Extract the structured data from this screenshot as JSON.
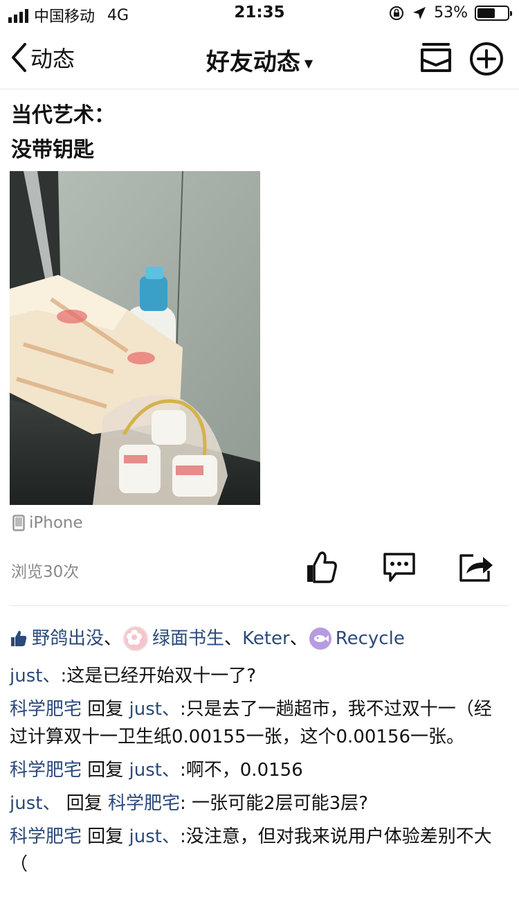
{
  "status_bar": {
    "carrier": "中国移动",
    "network": "4G",
    "time": "21:35",
    "battery": "53%",
    "battery_level": 0.53
  },
  "nav": {
    "back_label": "动态",
    "title": "好友动态"
  },
  "post": {
    "lines": [
      "当代艺术：",
      "没带钥匙"
    ],
    "device": "iPhone",
    "views": "浏览30次"
  },
  "likes": {
    "names": [
      "野鸽出没",
      "绿面书生",
      "Keter",
      "Recycle"
    ],
    "separator": "、"
  },
  "comments": [
    {
      "author": "just、",
      "reply_word": "",
      "target": "",
      "colon": ":",
      "text": "这是已经开始双十一了?"
    },
    {
      "author": "科学肥宅",
      "reply_word": " 回复 ",
      "target": "just、",
      "colon": ":",
      "text": "只是去了一趟超市，我不过双十一（经过计算双十一卫生纸0.00155一张，这个0.00156一张。"
    },
    {
      "author": "科学肥宅",
      "reply_word": " 回复 ",
      "target": "just、",
      "colon": ":",
      "text": "啊不，0.0156"
    },
    {
      "author": "just、",
      "reply_word": " 回复 ",
      "target": "科学肥宅",
      "colon": ": ",
      "text": "一张可能2层可能3层?"
    },
    {
      "author": "科学肥宅",
      "reply_word": " 回复 ",
      "target": "just、",
      "colon": ":",
      "text": "没注意，但对我来说用户体验差别不大（"
    }
  ],
  "colors": {
    "link": "#2b4a7a",
    "muted": "#888888",
    "avatar2": "#f4c6cc",
    "avatar4": "#b79be0"
  },
  "icons": [
    "signal-icon",
    "lock-rotation-icon",
    "location-arrow-icon",
    "battery-icon",
    "back-chevron-icon",
    "dropdown-caret-icon",
    "mail-icon",
    "add-circle-icon",
    "phone-icon",
    "like-icon",
    "comment-icon",
    "share-icon",
    "thumb-up-icon"
  ]
}
